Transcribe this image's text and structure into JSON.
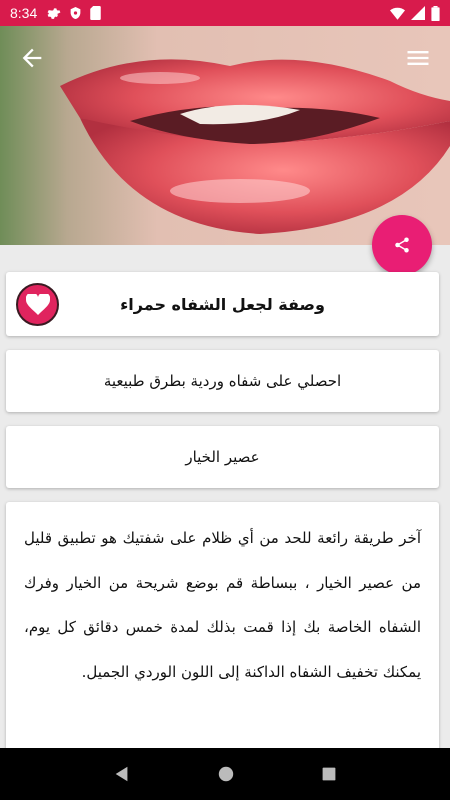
{
  "status_bar": {
    "time": "8:34"
  },
  "article": {
    "title": "وصفة لجعل الشفاه حمراء",
    "subtitle": "احصلي على شفاه وردية بطرق طبيعية",
    "section_title": "عصير الخيار",
    "body": "آخر طريقة رائعة للحد من أي ظلام على شفتيك هو تطبيق قليل من عصير الخيار ، ببساطة قم بوضع شريحة من الخيار وفرك الشفاه الخاصة بك إذا قمت بذلك لمدة خمس دقائق كل يوم، يمكنك تخفيف الشفاه الداكنة إلى اللون الوردي الجميل."
  },
  "colors": {
    "accent": "#e91e74",
    "status": "#d81b4c",
    "heart": "#e0245e"
  },
  "icons": {
    "back": "arrow-left-icon",
    "menu": "hamburger-menu-icon",
    "share": "share-icon",
    "favorite": "heart-icon"
  }
}
